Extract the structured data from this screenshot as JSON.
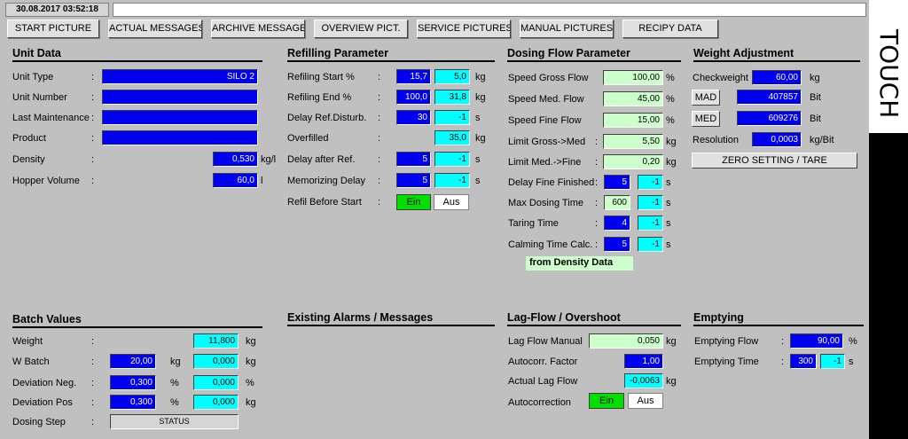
{
  "header": {
    "datetime": "30.08.2017 03:52:18",
    "message": ""
  },
  "nav": [
    "START PICTURE",
    "ACTUAL MESSAGES",
    "ARCHIVE MESSAGES",
    "OVERVIEW PICT.",
    "SERVICE PICTURES",
    "MANUAL PICTURES",
    "RECIPY DATA"
  ],
  "touch_label": "TOUCH",
  "colon": ":",
  "unit_data": {
    "title": "Unit Data",
    "unit_type_label": "Unit Type",
    "unit_type": "SILO 2",
    "unit_number_label": "Unit Number",
    "unit_number": "",
    "last_maint_label": "Last Maintenance",
    "last_maint": "",
    "product_label": "Product",
    "product": "",
    "density_label": "Density",
    "density": "0,530",
    "density_unit": "kg/l",
    "hopper_label": "Hopper Volume",
    "hopper": "60,0",
    "hopper_unit": "l"
  },
  "refill": {
    "title": "Refilling Parameter",
    "start_label": "Refiling Start %",
    "start_pct": "15,7",
    "start_kg": "5,0",
    "end_label": "Refiling End %",
    "end_pct": "100,0",
    "end_kg": "31,8",
    "delay_dist_label": "Delay Ref.Disturb.",
    "delay_dist": "30",
    "delay_dist_act": "-1",
    "overfilled_label": "Overfilled",
    "overfilled": "35,0",
    "delay_after_label": "Delay after Ref.",
    "delay_after": "5",
    "delay_after_act": "-1",
    "memo_label": "Memorizing Delay",
    "memo": "5",
    "memo_act": "-1",
    "refill_before_label": "Refil Before Start",
    "unit_kg": "kg",
    "unit_s": "s",
    "ein": "Ein",
    "aus": "Aus"
  },
  "dosing": {
    "title": "Dosing  Flow  Parameter",
    "gross_label": "Speed Gross Flow",
    "gross": "100,00",
    "med_label": "Speed Med. Flow",
    "med": "45,00",
    "fine_label": "Speed Fine Flow",
    "fine": "15,00",
    "lim_gm_label": "Limit  Gross->Med",
    "lim_gm": "5,50",
    "lim_mf_label": "Limit  Med.->Fine",
    "lim_mf": "0,20",
    "fine_fin_label": "Delay Fine Finished",
    "fine_fin": "5",
    "fine_fin_act": "-1",
    "max_dose_label": "Max Dosing Time",
    "max_dose": "600",
    "max_dose_act": "-1",
    "taring_label": "Taring Time",
    "taring": "4",
    "taring_act": "-1",
    "calming_label": "Calming Time Calc.",
    "calming": "5",
    "calming_act": "-1",
    "from_density": "from Density Data",
    "unit_pct": "%",
    "unit_kg": "kg",
    "unit_s": "s"
  },
  "weight": {
    "title": "Weight Adjustment",
    "check_label": "Checkweight",
    "check": "60,00",
    "check_unit": "kg",
    "mad_label": "MAD",
    "mad": "407857",
    "mad_unit": "Bit",
    "med_label": "MED",
    "med": "609276",
    "med_unit": "Bit",
    "res_label": "Resolution",
    "res": "0,0003",
    "res_unit": "kg/Bit",
    "zero_btn": "ZERO SETTING / TARE"
  },
  "batch": {
    "title": "Batch Values",
    "weight_label": "Weight",
    "weight": "11,800",
    "wbatch_label": "W Batch",
    "wbatch": "20,00",
    "wbatch_act": "0,000",
    "devneg_label": "Deviation Neg.",
    "devneg": "0,300",
    "devneg_act": "0,000",
    "devpos_label": "Deviation Pos",
    "devpos": "0,300",
    "devpos_act": "0,000",
    "step_label": "Dosing Step",
    "step": "STATUS",
    "unit_kg": "kg",
    "unit_pct": "%"
  },
  "alarms": {
    "title": "Existing Alarms / Messages"
  },
  "lag": {
    "title": "Lag-Flow / Overshoot",
    "manual_label": "Lag Flow Manual",
    "manual": "0,050",
    "autocorr_label": "Autocorr. Factor",
    "autocorr": "1,00",
    "actual_label": "Actual Lag Flow",
    "actual": "-0,0063",
    "autocorrection_label": "Autocorrection",
    "unit_kg": "kg",
    "ein": "Ein",
    "aus": "Aus"
  },
  "emptying": {
    "title": "Emptying",
    "flow_label": "Emptying Flow",
    "flow": "90,00",
    "flow_unit": "%",
    "time_label": "Emptying Time",
    "time": "300",
    "time_act": "-1",
    "time_unit": "s"
  }
}
